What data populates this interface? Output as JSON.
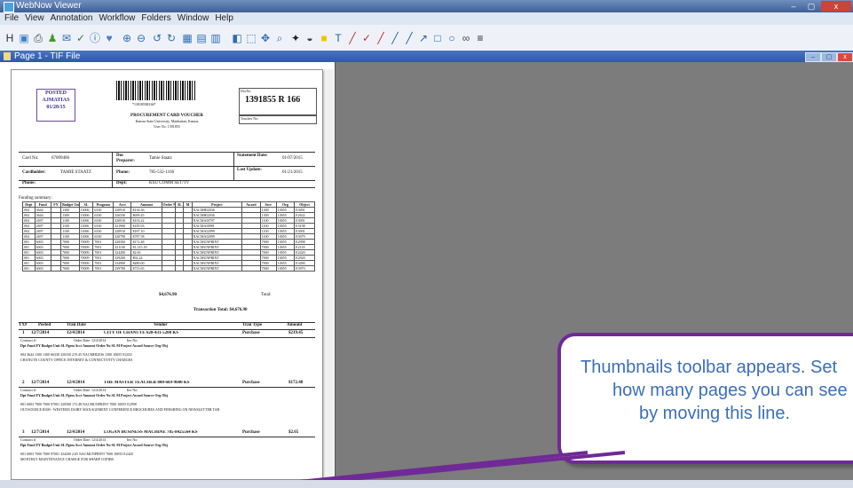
{
  "app": {
    "title": "WebNow Viewer",
    "window_controls": {
      "minimize": "–",
      "maximize": "▢",
      "close": "x"
    }
  },
  "menu": [
    "File",
    "View",
    "Annotation",
    "Workflow",
    "Folders",
    "Window",
    "Help"
  ],
  "toolbar_icons": [
    {
      "name": "h-icon",
      "glyph": "H",
      "color": "#1d2b4c"
    },
    {
      "name": "scan-icon",
      "glyph": "▣",
      "color": "#3b82c4"
    },
    {
      "name": "print-icon",
      "glyph": "⎙",
      "color": "#2c3e50"
    },
    {
      "name": "user-icon",
      "glyph": "♟",
      "color": "#3f9b2f"
    },
    {
      "name": "send-icon",
      "glyph": "✉",
      "color": "#2b6cb0"
    },
    {
      "name": "check-icon",
      "glyph": "✓",
      "color": "#2e7d32"
    },
    {
      "name": "info-icon",
      "glyph": "ⓘ",
      "color": "#1f5fb0"
    },
    {
      "name": "heart-icon",
      "glyph": "♥",
      "color": "#4f7fb8"
    },
    {
      "name": "zoom-in-icon",
      "glyph": "⊕",
      "color": "#2f6cb3"
    },
    {
      "name": "zoom-out-icon",
      "glyph": "⊖",
      "color": "#2f6cb3"
    },
    {
      "name": "rotate-left-icon",
      "glyph": "↺",
      "color": "#2f6cb3"
    },
    {
      "name": "rotate-right-icon",
      "glyph": "↻",
      "color": "#2f6cb3"
    },
    {
      "name": "fit-page-icon",
      "glyph": "▦",
      "color": "#2f6cb3"
    },
    {
      "name": "fit-width-icon",
      "glyph": "▤",
      "color": "#2f6cb3"
    },
    {
      "name": "double-page-icon",
      "glyph": "▥",
      "color": "#2f6cb3"
    },
    {
      "name": "thumbnail-icon",
      "glyph": "◧",
      "color": "#2f6cb3"
    },
    {
      "name": "select-icon",
      "glyph": "⬚",
      "color": "#2f6cb3"
    },
    {
      "name": "pan-icon",
      "glyph": "✥",
      "color": "#2f6cb3"
    },
    {
      "name": "magnifier-icon",
      "glyph": "⌕",
      "color": "#2f6cb3"
    },
    {
      "name": "pin-icon",
      "glyph": "✦",
      "color": "#222222"
    },
    {
      "name": "stamp-icon",
      "glyph": "◒",
      "color": "#3b3b3b"
    },
    {
      "name": "highlight-icon",
      "glyph": "■",
      "color": "#f2c500"
    },
    {
      "name": "text-icon",
      "glyph": "T",
      "color": "#1f5fb0"
    },
    {
      "name": "pen-icon",
      "glyph": "╱",
      "color": "#c62828"
    },
    {
      "name": "checkmark-icon",
      "glyph": "✓",
      "color": "#c62828"
    },
    {
      "name": "line-red-icon",
      "glyph": "╱",
      "color": "#c62828"
    },
    {
      "name": "line-blue-icon",
      "glyph": "╱",
      "color": "#1f5fb0"
    },
    {
      "name": "line-icon",
      "glyph": "╱",
      "color": "#1f5fb0"
    },
    {
      "name": "arrow-icon",
      "glyph": "↗",
      "color": "#1f5fb0"
    },
    {
      "name": "rectangle-icon",
      "glyph": "□",
      "color": "#1f5fb0"
    },
    {
      "name": "ellipse-icon",
      "glyph": "○",
      "color": "#1f5fb0"
    },
    {
      "name": "link-icon",
      "glyph": "∞",
      "color": "#444444"
    },
    {
      "name": "menu-icon",
      "glyph": "≡",
      "color": "#222222"
    }
  ],
  "document": {
    "title": "Page 1 - TIF File",
    "controls": {
      "minimize": "–",
      "restore": "▢",
      "close": "x"
    }
  },
  "voucher": {
    "posted_stamp": [
      "POSTED",
      "AJMATIAS",
      "01/28/15"
    ],
    "barcode_text": "*1391855R166*",
    "title": "PROCUREMENT CARD VOUCHER",
    "subtitle_line1": "Kansas State University, Manhattan, Kansas",
    "subtitle_line2": "User No: 1391855",
    "doc_label": "DocNo",
    "doc_number": "1391855 R 166",
    "vendor_label": "Voucher No:",
    "fields": {
      "card_no_label": "Card No:",
      "card_no": "67009466",
      "cardholder_label": "Cardholder:",
      "cardholder": "TAMIE STAATZ",
      "phone_label": "Phone:",
      "doc_preparer_label": "Doc Preparer:",
      "doc_preparer": "Tamie Staatz",
      "phone2_label": "Phone:",
      "phone2": "785-532-1166",
      "dept_label": "Dept:",
      "dept": "KSU COMM SET/TV",
      "statement_date_label": "Statement Date:",
      "statement_date": "01/07/2015",
      "last_update_label": "Last Update:",
      "last_update": "01/21/2015"
    },
    "funding_summary_label": "Funding summary:",
    "funding_headers": [
      "Dept",
      "Fund",
      "FY",
      "Budget Unit",
      "SL",
      "Program",
      "Acct",
      "Amount",
      "Order No",
      "SL",
      "M",
      "Project",
      "Award",
      "Srce",
      "Org",
      "Object"
    ],
    "funding_rows": [
      [
        "004",
        "3644",
        "",
        "1300",
        "13006",
        "6330",
        "320910",
        "$136.36",
        "",
        "",
        "",
        "NACMHI2036",
        "",
        "1300",
        "10055",
        "E3091"
      ],
      [
        "004",
        "3644",
        "",
        "1300",
        "13006",
        "6330",
        "326330",
        "$699.45",
        "",
        "",
        "",
        "NACMHI2036",
        "",
        "1300",
        "10055",
        "E2632"
      ],
      [
        "004",
        "2697",
        "",
        "1100",
        "11006",
        "6330",
        "320910",
        "$103.22",
        "",
        "",
        "",
        "NACMAI0797",
        "",
        "1100",
        "10055",
        "E3091"
      ],
      [
        "004",
        "2697",
        "",
        "1100",
        "11006",
        "6330",
        "321900",
        "$185.93",
        "",
        "",
        "",
        "NACMAI0981",
        "",
        "1100",
        "10055",
        "E3198"
      ],
      [
        "004",
        "2697",
        "",
        "1100",
        "11006",
        "6330",
        "320910",
        "$187.10",
        "",
        "",
        "",
        "NACMAI2099",
        "",
        "1100",
        "10055",
        "E3091"
      ],
      [
        "004",
        "2697",
        "",
        "1100",
        "11006",
        "6330",
        "320790",
        "$787.58",
        "",
        "",
        "",
        "NACMAI2099",
        "",
        "1100",
        "10055",
        "E3079"
      ],
      [
        "001",
        "6003",
        "",
        "7000",
        "70009",
        "7001",
        "320500",
        "$172.48",
        "",
        "",
        "",
        "NACMUNPRINT",
        "",
        "7000",
        "10055",
        "E2998"
      ],
      [
        "001",
        "6003",
        "",
        "7000",
        "70009",
        "7001",
        "321100",
        "$1,315.18",
        "",
        "",
        "",
        "NACMUNPRINT",
        "",
        "7000",
        "10055",
        "E2118"
      ],
      [
        "001",
        "6003",
        "",
        "7000",
        "70009",
        "7001",
        "324200",
        "$2.65",
        "",
        "",
        "",
        "NACMUNPRINT",
        "",
        "7000",
        "10055",
        "E2420"
      ],
      [
        "001",
        "6003",
        "",
        "7000",
        "70009",
        "7001",
        "329200",
        "$92.24",
        "",
        "",
        "",
        "NACMUNPRINT",
        "",
        "7000",
        "10055",
        "E2920"
      ],
      [
        "001",
        "6003",
        "",
        "7000",
        "70009",
        "7001",
        "334900",
        "$480.00",
        "",
        "",
        "",
        "NACMUNPRINT",
        "",
        "7000",
        "10055",
        "E3490"
      ],
      [
        "001",
        "6003",
        "",
        "7000",
        "70009",
        "7001",
        "339700",
        "$715.65",
        "",
        "",
        "",
        "NACMUNPRINT",
        "",
        "7000",
        "10055",
        "E3970"
      ]
    ],
    "funding_total": "$4,676.90",
    "total_label": "Total:",
    "transaction_total": "Transaction Total: $4,676.90",
    "trx_headers": [
      "TX#",
      "Posted",
      "Tran Date",
      "Vendor",
      "Tran Type",
      "Amount"
    ],
    "transactions": [
      {
        "num": "1",
        "posted": "12/7/2014",
        "tran_date": "12/4/2014",
        "vendor": "CITY OF CHANUTE 620-431-5200 KS",
        "type": "Purchase",
        "amount": "$219.45",
        "contract": "Contract #:",
        "order_date": "Order Date: 12/4/2014",
        "inv": "Inv No:",
        "detail": "004 3644 1300 1300 66330 320330 219.45 NACMHI2036 1300 10055 E2433",
        "desc": "CHANUTE COUNTY OFFICE INTERNET & CONNECTIVITY CHARGES"
      },
      {
        "num": "2",
        "posted": "12/7/2014",
        "tran_date": "12/4/2014",
        "vendor": "THE MASTER TEACHER 800-669-9600 KS",
        "type": "Purchase",
        "amount": "$172.48",
        "contract": "Contract #:",
        "order_date": "Order Date: 12/4/2014",
        "inv": "Inv No:",
        "detail": "001 6003 7000 7000 97001 320500 172.48 NACMUNPRINT 7000 10055 E2998",
        "desc": "OUTSOURCE R300 - WESTERN DAIRY MANAGEMENT CONFERENCE BROCHURES AND FINISHING ON NEWSLETTER TAB"
      },
      {
        "num": "3",
        "posted": "12/7/2014",
        "tran_date": "12/4/2014",
        "vendor": "LOGAN BUSINESS MACHINE 785-8425564 KS",
        "type": "Purchase",
        "amount": "$2.65",
        "contract": "Contract #:",
        "order_date": "Order Date: 12/4/2014",
        "inv": "Inv No:",
        "detail": "001 6003 7000 7000 97001 324200 2.65 NACMUNPRINT 7000 10055 E2420",
        "desc": "MONTHLY MAINTENANCE CHARGE FOR SHARP COPIER"
      }
    ],
    "trx_sub_headers": "Dpt Fund FY Budget Unit SL Pgrm Acct Amount Order No SL M Project Award Source Org Obj"
  },
  "callout": {
    "lines": [
      "Thumbnails toolbar appears. Set",
      "how many pages you can see",
      "by moving this line."
    ]
  },
  "colors": {
    "accent": "#6f2a96",
    "callout_text": "#3b6fb9",
    "workspace": "#7c7c7c"
  }
}
